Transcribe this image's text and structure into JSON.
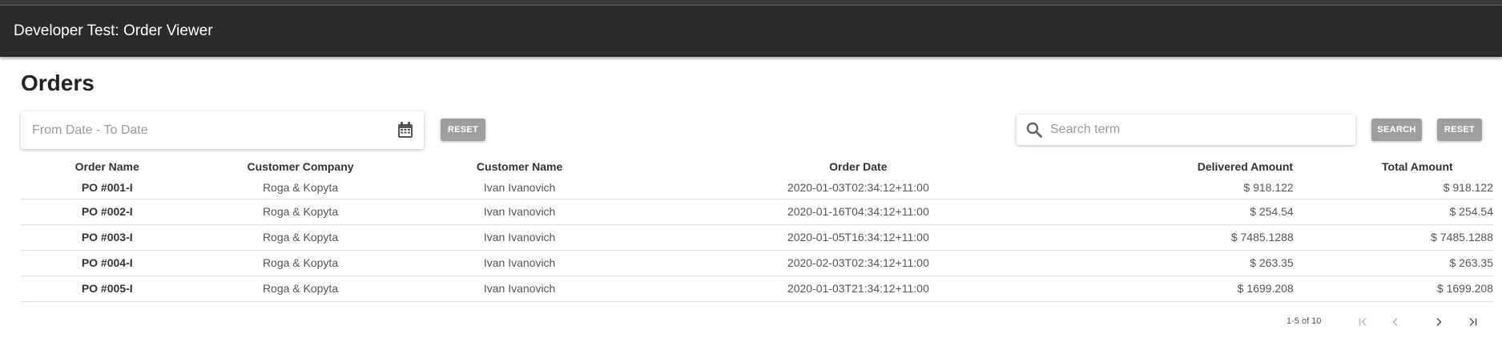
{
  "app": {
    "title": "Developer Test: Order Viewer"
  },
  "page": {
    "title": "Orders"
  },
  "filters": {
    "date_placeholder": "From Date - To Date",
    "date_reset_label": "RESET",
    "search_placeholder": "Search term",
    "search_label": "SEARCH",
    "search_reset_label": "RESET"
  },
  "table": {
    "headers": {
      "order_name": "Order Name",
      "customer_company": "Customer Company",
      "customer_name": "Customer Name",
      "order_date": "Order Date",
      "delivered_amount": "Delivered Amount",
      "total_amount": "Total Amount"
    },
    "rows": [
      {
        "order_name": "PO #001-I",
        "customer_company": "Roga & Kopyta",
        "customer_name": "Ivan Ivanovich",
        "order_date": "2020-01-03T02:34:12+11:00",
        "delivered_amount": "$ 918.122",
        "total_amount": "$ 918.122"
      },
      {
        "order_name": "PO #002-I",
        "customer_company": "Roga & Kopyta",
        "customer_name": "Ivan Ivanovich",
        "order_date": "2020-01-16T04:34:12+11:00",
        "delivered_amount": "$ 254.54",
        "total_amount": "$ 254.54"
      },
      {
        "order_name": "PO #003-I",
        "customer_company": "Roga & Kopyta",
        "customer_name": "Ivan Ivanovich",
        "order_date": "2020-01-05T16:34:12+11:00",
        "delivered_amount": "$ 7485.1288",
        "total_amount": "$ 7485.1288"
      },
      {
        "order_name": "PO #004-I",
        "customer_company": "Roga & Kopyta",
        "customer_name": "Ivan Ivanovich",
        "order_date": "2020-02-03T02:34:12+11:00",
        "delivered_amount": "$ 263.35",
        "total_amount": "$ 263.35"
      },
      {
        "order_name": "PO #005-I",
        "customer_company": "Roga & Kopyta",
        "customer_name": "Ivan Ivanovich",
        "order_date": "2020-01-03T21:34:12+11:00",
        "delivered_amount": "$ 1699.208",
        "total_amount": "$ 1699.208"
      }
    ]
  },
  "pagination": {
    "range_label": "1-5 of 10"
  },
  "icons": {
    "calendar": "calendar-icon",
    "search": "search-icon",
    "first_page": "first-page-icon",
    "prev_page": "chevron-left-icon",
    "next_page": "chevron-right-icon",
    "last_page": "last-page-icon"
  },
  "colors": {
    "appbar": "#2b2b2b",
    "button": "#9e9e9e",
    "divider": "#e0e0e0"
  }
}
